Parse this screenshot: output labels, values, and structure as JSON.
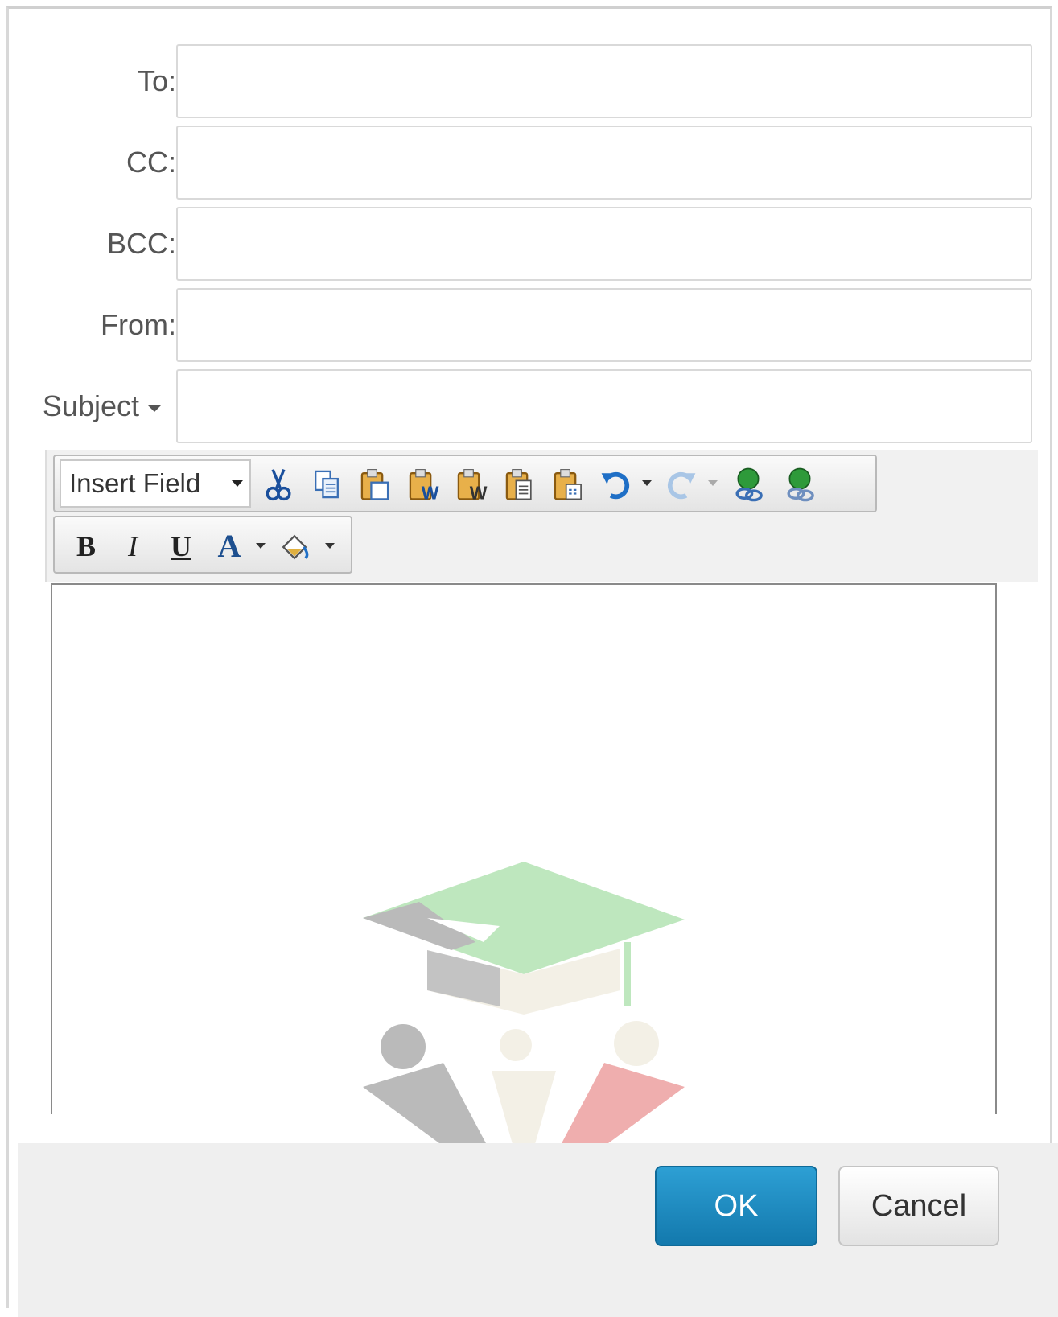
{
  "form": {
    "to_label": "To:",
    "cc_label": "CC:",
    "bcc_label": "BCC:",
    "from_label": "From:",
    "subject_label": "Subject",
    "to_value": "",
    "cc_value": "",
    "bcc_value": "",
    "from_value": "",
    "subject_value": ""
  },
  "toolbar": {
    "insert_field": "Insert Field",
    "icons": [
      "cut-icon",
      "copy-icon",
      "paste-icon",
      "paste-from-word-icon",
      "paste-from-word-strip-icon",
      "paste-as-text-icon",
      "paste-html-icon",
      "undo-icon",
      "redo-icon",
      "hyperlink-icon",
      "remove-link-icon"
    ]
  },
  "format": {
    "bold": "B",
    "italic": "I",
    "underline": "U",
    "fore_color": "A",
    "back_color_icon": "paint-bucket-icon"
  },
  "editor": {
    "content": ""
  },
  "buttons": {
    "ok": "OK",
    "cancel": "Cancel"
  },
  "colors": {
    "ok_bg": "#1f8cc4",
    "toolbar_bg": "#f1f1f1",
    "footer_bg": "#efefef"
  }
}
